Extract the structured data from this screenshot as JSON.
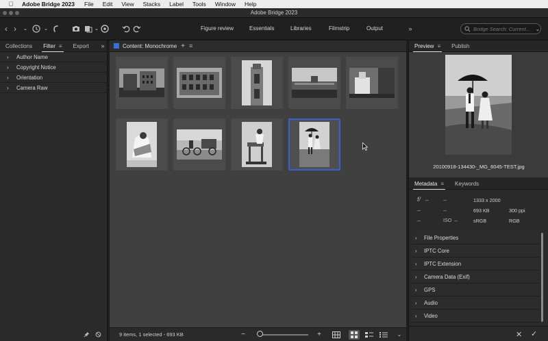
{
  "menubar": {
    "app": "Adobe Bridge 2023",
    "items": [
      "File",
      "Edit",
      "View",
      "Stacks",
      "Label",
      "Tools",
      "Window",
      "Help"
    ]
  },
  "window": {
    "title": "Adobe Bridge 2023"
  },
  "workspaces": [
    "Figure review",
    "Essentials",
    "Libraries",
    "Filmstrip",
    "Output"
  ],
  "search": {
    "placeholder": "Bridge Search: Current..."
  },
  "left_panel": {
    "tabs": [
      "Collections",
      "Filter",
      "Export"
    ],
    "active_tab": "Filter",
    "filters": [
      "Author Name",
      "Copyright Notice",
      "Orientation",
      "Camera Raw"
    ]
  },
  "content": {
    "title": "Content: Monochrome",
    "status": "9 items, 1 selected - 693 KB",
    "item_count": 9,
    "selected_index": 8
  },
  "right_panel": {
    "preview_tabs": [
      "Preview",
      "Publish"
    ],
    "active_preview_tab": "Preview",
    "preview_filename": "20100918-134430-_MG_6045-TEST.jpg",
    "metadata_tabs": [
      "Metadata",
      "Keywords"
    ],
    "active_metadata_tab": "Metadata",
    "summary": {
      "aperture_icon": "f/",
      "aperture": "--",
      "shutter": "--",
      "col1_row2": "--",
      "col2_row2": "--",
      "col1_row3": "--",
      "iso_label": "ISO",
      "iso": "--",
      "dimensions": "1333 x 2000",
      "file_size": "693 KB",
      "resolution": "300 ppi",
      "color_profile": "sRGB",
      "color_mode": "RGB"
    },
    "sections": [
      "File Properties",
      "IPTC Core",
      "IPTC Extension",
      "Camera Data (Exif)",
      "GPS",
      "Audio",
      "Video"
    ]
  },
  "colors": {
    "accent": "#3b5fcf",
    "panel_bg": "#2a2a2a",
    "content_bg": "#404040"
  }
}
